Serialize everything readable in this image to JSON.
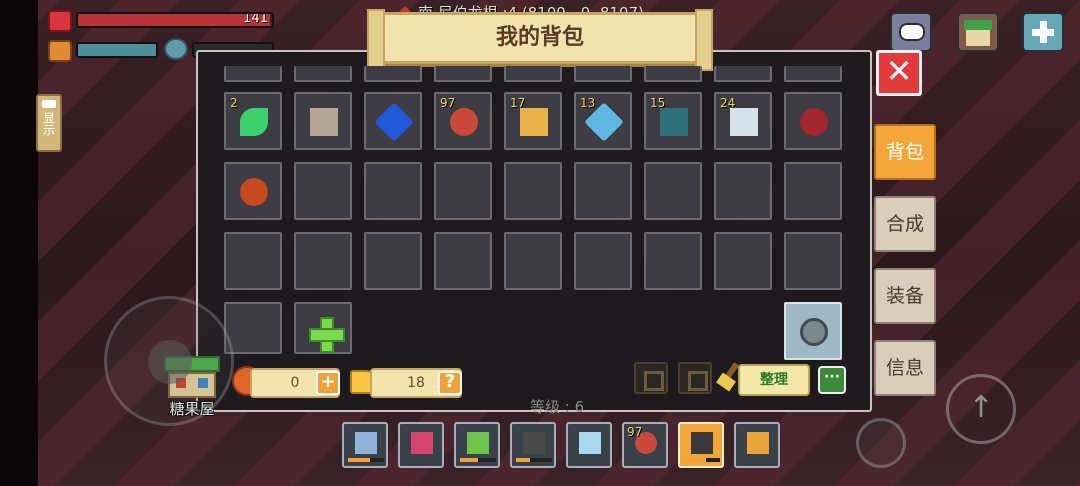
{
  "hud": {
    "coords_text": "南  尼伯龙根 :4 (8109, -9, 8107)",
    "hp_value": "141",
    "hp_fraction": 0.99,
    "food_fraction": 1.0,
    "oxygen_fraction": 0.0,
    "side_tab_label": "显示"
  },
  "top_buttons": {
    "chat_icon": "chat-bubble-icon",
    "shop_icon": "shop-icon",
    "plus_icon": "plus-icon"
  },
  "panel": {
    "title": "我的背包",
    "close_label": "✕"
  },
  "side_menu": {
    "tabs": [
      {
        "label": "背包",
        "active": true
      },
      {
        "label": "合成",
        "active": false
      },
      {
        "label": "装备",
        "active": false
      },
      {
        "label": "信息",
        "active": false
      }
    ]
  },
  "inventory": {
    "row1": [
      {
        "count": "2",
        "icon": "green-leaf-icon",
        "color": "#3ccf6a"
      },
      {
        "count": "",
        "icon": "stone-slab-icon",
        "color": "#b5a79a"
      },
      {
        "count": "",
        "icon": "blue-gem-icon",
        "color": "#1f58d8"
      },
      {
        "count": "97",
        "icon": "meat-icon",
        "color": "#c94a3a"
      },
      {
        "count": "17",
        "icon": "potion-icon",
        "color": "#e7b24a"
      },
      {
        "count": "13",
        "icon": "blue-crystal-icon",
        "color": "#5fb8e0"
      },
      {
        "count": "15",
        "icon": "dark-fish-icon",
        "color": "#2f6f7a"
      },
      {
        "count": "24",
        "icon": "white-shell-icon",
        "color": "#d5e2ea"
      },
      {
        "count": "",
        "icon": "red-meat-icon",
        "color": "#a2262e"
      }
    ],
    "row2": [
      {
        "count": "",
        "icon": "lava-rock-icon",
        "color": "#c5481f"
      }
    ]
  },
  "bottom": {
    "candy_house_label": "糖果屋",
    "coin_value": "0",
    "coin_add": "+",
    "cheese_value": "18",
    "cheese_help": "?",
    "sort_label": "整理",
    "more_label": "···",
    "level_text": "等级 : 6"
  },
  "hotbar": [
    {
      "icon": "axe-icon",
      "count": "",
      "durability": 0.6,
      "color": "#8fb4d9",
      "selected": false
    },
    {
      "icon": "red-shovel-icon",
      "count": "",
      "durability": 0,
      "color": "#d5446b",
      "selected": false
    },
    {
      "icon": "green-pick-icon",
      "count": "",
      "durability": 0.5,
      "color": "#6fc24a",
      "selected": false
    },
    {
      "icon": "dark-sword-icon",
      "count": "",
      "durability": 0.4,
      "color": "#4a4a4a",
      "selected": false
    },
    {
      "icon": "ice-block-icon",
      "count": "",
      "durability": 0,
      "color": "#a8d8f0",
      "selected": false
    },
    {
      "icon": "meat-icon",
      "count": "97",
      "durability": 0,
      "color": "#c94a3a",
      "selected": false
    },
    {
      "icon": "blade-icon",
      "count": "",
      "durability": 0.6,
      "color": "#3a3a3a",
      "selected": true
    },
    {
      "icon": "beer-mug-icon",
      "count": "",
      "durability": 0,
      "color": "#e8a33a",
      "selected": false
    }
  ],
  "controls": {
    "jump_label": "↑"
  }
}
